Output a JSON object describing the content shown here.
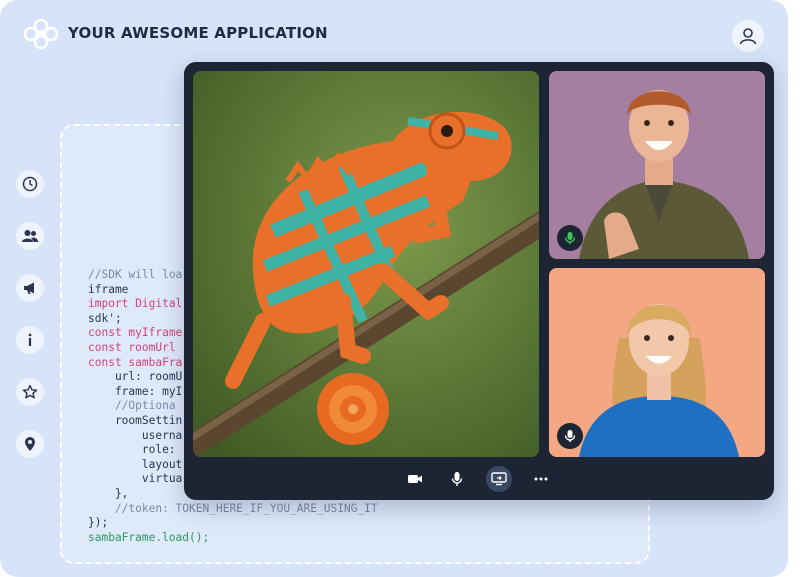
{
  "header": {
    "app_title": "YOUR AWESOME APPLICATION",
    "logo_icon": "flower-logo-icon",
    "user_icon": "user-icon"
  },
  "sidebar": {
    "items": [
      {
        "icon": "clock-icon"
      },
      {
        "icon": "users-icon"
      },
      {
        "icon": "megaphone-icon"
      },
      {
        "icon": "info-icon"
      },
      {
        "icon": "star-icon"
      },
      {
        "icon": "map-pin-icon"
      }
    ]
  },
  "code": {
    "lines": [
      "//SDK will loa",
      "iframe",
      "import Digital",
      "sdk';",
      "const myIframe",
      "const roomUrl",
      "const sambaFra",
      "    url: roomU",
      "    frame: myI",
      "    //Optiona",
      "    roomSettin",
      "        userna",
      "        role:",
      "        layout",
      "        virtua",
      "    },",
      "    //token: TOKEN_HERE_IF_YOU_ARE_USING_IT",
      "});",
      "sambaFrame.load();"
    ]
  },
  "video": {
    "tiles": [
      {
        "subject": "chameleon"
      },
      {
        "subject": "smiling man",
        "mic": "active",
        "bg": "#a57fa0"
      },
      {
        "subject": "smiling woman",
        "mic": "idle",
        "bg": "#f4a783"
      }
    ],
    "controls": [
      {
        "icon": "camera-icon"
      },
      {
        "icon": "microphone-icon"
      },
      {
        "icon": "screen-share-icon",
        "active": true
      },
      {
        "icon": "more-icon"
      }
    ]
  },
  "colors": {
    "background": "#d6e3f8",
    "window": "#1d2433",
    "mic_active": "#3ec85a"
  }
}
